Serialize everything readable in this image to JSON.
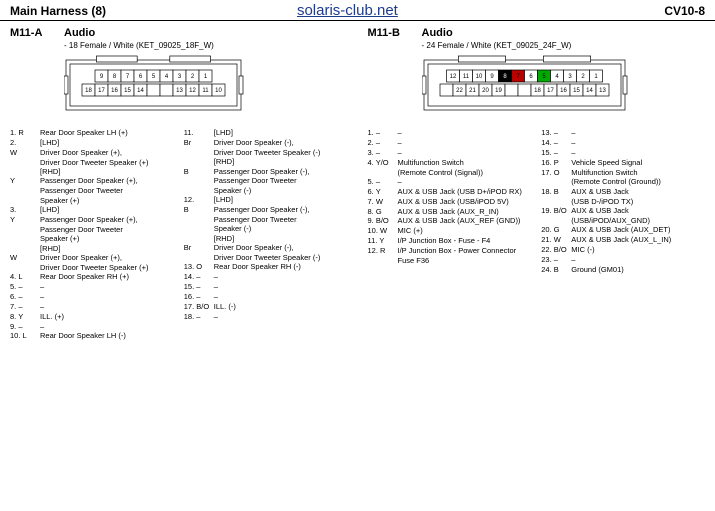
{
  "header": {
    "title": "Main Harness (8)",
    "site": "solaris-club.net",
    "page": "CV10-8"
  },
  "connectorA": {
    "id": "M11-A",
    "name": "Audio",
    "sub": "- 18 Female / White (KET_09025_18F_W)",
    "topRow": [
      "9",
      "8",
      "7",
      "6",
      "5",
      "4",
      "3",
      "2",
      "1"
    ],
    "botRow": [
      "18",
      "17",
      "16",
      "15",
      "14",
      "",
      "",
      "13",
      "12",
      "11",
      "10"
    ],
    "blanks": [
      5,
      6
    ],
    "pinsL": [
      {
        "n": "1. R",
        "d": "Rear Door Speaker LH (+)"
      },
      {
        "n": "2.",
        "d": "[LHD]"
      },
      {
        "n": "   W",
        "d": "Driver Door Speaker (+),"
      },
      {
        "n": "",
        "d": "Driver Door Tweeter Speaker (+)"
      },
      {
        "n": "",
        "d": "[RHD]"
      },
      {
        "n": "   Y",
        "d": "Passenger Door Speaker (+),"
      },
      {
        "n": "",
        "d": "Passenger Door Tweeter"
      },
      {
        "n": "",
        "d": "Speaker (+)"
      },
      {
        "n": "3.",
        "d": "[LHD]"
      },
      {
        "n": "   Y",
        "d": "Passenger Door Speaker (+),"
      },
      {
        "n": "",
        "d": "Passenger Door Tweeter"
      },
      {
        "n": "",
        "d": "Speaker (+)"
      },
      {
        "n": "",
        "d": "[RHD]"
      },
      {
        "n": "   W",
        "d": "Driver Door Speaker (+),"
      },
      {
        "n": "",
        "d": "Driver Door Tweeter Speaker (+)"
      },
      {
        "n": "4. L",
        "d": "Rear Door Speaker RH (+)"
      },
      {
        "n": "5. –",
        "d": "–"
      },
      {
        "n": "6. –",
        "d": "–"
      },
      {
        "n": "7. –",
        "d": "–"
      },
      {
        "n": "8. Y",
        "d": "ILL. (+)"
      },
      {
        "n": "9. –",
        "d": "–"
      },
      {
        "n": "10. L",
        "d": "Rear Door Speaker LH (-)"
      }
    ],
    "pinsR": [
      {
        "n": "11.",
        "d": "[LHD]"
      },
      {
        "n": "   Br",
        "d": "Driver Door Speaker (-),"
      },
      {
        "n": "",
        "d": "Driver Door Tweeter Speaker (-)"
      },
      {
        "n": "",
        "d": "[RHD]"
      },
      {
        "n": "   B",
        "d": "Passenger Door Speaker (-),"
      },
      {
        "n": "",
        "d": "Passenger Door Tweeter"
      },
      {
        "n": "",
        "d": "Speaker (-)"
      },
      {
        "n": "12.",
        "d": "[LHD]"
      },
      {
        "n": "   B",
        "d": "Passenger Door Speaker (-),"
      },
      {
        "n": "",
        "d": "Passenger Door Tweeter"
      },
      {
        "n": "",
        "d": "Speaker (-)"
      },
      {
        "n": "",
        "d": "[RHD]"
      },
      {
        "n": "   Br",
        "d": "Driver Door Speaker (-),"
      },
      {
        "n": "",
        "d": "Driver Door Tweeter Speaker (-)"
      },
      {
        "n": "13. O",
        "d": "Rear Door Speaker RH (-)"
      },
      {
        "n": "14. –",
        "d": "–"
      },
      {
        "n": "15. –",
        "d": "–"
      },
      {
        "n": "16. –",
        "d": "–"
      },
      {
        "n": "17. B/O",
        "d": "ILL. (-)"
      },
      {
        "n": "18. –",
        "d": "–"
      }
    ]
  },
  "connectorB": {
    "id": "M11-B",
    "name": "Audio",
    "sub": "- 24 Female / White (KET_09025_24F_W)",
    "topRow": [
      "12",
      "11",
      "10",
      "9",
      "8",
      "7",
      "6",
      "5",
      "4",
      "3",
      "2",
      "1"
    ],
    "botRow": [
      "",
      "22",
      "21",
      "20",
      "19",
      "",
      "",
      "18",
      "17",
      "16",
      "15",
      "14",
      "13"
    ],
    "blanks": [
      0,
      5,
      6
    ],
    "colored": {
      "8": "#000",
      "7": "#b00",
      "6": "#fff",
      "5": "#0a0"
    },
    "pinsL": [
      {
        "n": "1. –",
        "d": "–"
      },
      {
        "n": "2. –",
        "d": "–"
      },
      {
        "n": "3. –",
        "d": "–"
      },
      {
        "n": "4. Y/O",
        "d": "Multifunction Switch"
      },
      {
        "n": "",
        "d": "(Remote Control (Signal))"
      },
      {
        "n": "5. –",
        "d": "–"
      },
      {
        "n": "6. Y",
        "d": "AUX & USB Jack (USB D+/iPOD RX)"
      },
      {
        "n": "7. W",
        "d": "AUX & USB Jack (USB/iPOD 5V)"
      },
      {
        "n": "8. G",
        "d": "AUX & USB Jack (AUX_R_IN)"
      },
      {
        "n": "9. B/O",
        "d": "AUX & USB Jack (AUX_REF (GND))"
      },
      {
        "n": "10. W",
        "d": "MIC (+)"
      },
      {
        "n": "11. Y",
        "d": "I/P Junction Box - Fuse - F4"
      },
      {
        "n": "12. R",
        "d": "I/P Junction Box - Power Connector"
      },
      {
        "n": "",
        "d": "Fuse F36"
      }
    ],
    "pinsR": [
      {
        "n": "13. –",
        "d": "–"
      },
      {
        "n": "14. –",
        "d": "–"
      },
      {
        "n": "15. –",
        "d": "–"
      },
      {
        "n": "16. P",
        "d": "Vehicle Speed Signal"
      },
      {
        "n": "17. O",
        "d": "Multifunction Switch"
      },
      {
        "n": "",
        "d": "(Remote Control (Ground))"
      },
      {
        "n": "18. B",
        "d": "AUX & USB Jack"
      },
      {
        "n": "",
        "d": "(USB D-/iPOD TX)"
      },
      {
        "n": "19. B/O",
        "d": "AUX & USB Jack"
      },
      {
        "n": "",
        "d": "(USB/iPOD/AUX_GND)"
      },
      {
        "n": "20. G",
        "d": "AUX & USB Jack (AUX_DET)"
      },
      {
        "n": "21. W",
        "d": "AUX & USB Jack (AUX_L_IN)"
      },
      {
        "n": "22. B/O",
        "d": "MIC (-)"
      },
      {
        "n": "23. –",
        "d": "–"
      },
      {
        "n": "24. B",
        "d": "Ground (GM01)"
      }
    ]
  }
}
